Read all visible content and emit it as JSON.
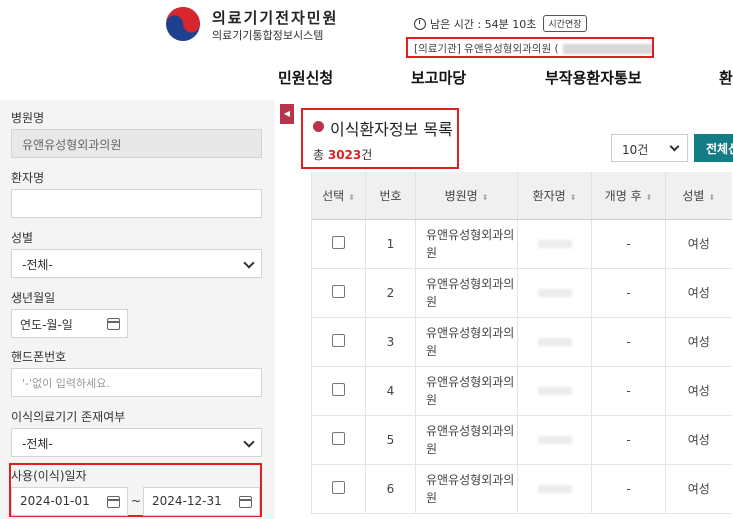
{
  "brand": {
    "title": "의료기기전자민원",
    "subtitle": "의료기기통합정보시스템"
  },
  "session": {
    "remaining_label": "남은 시간 : 54분 10초",
    "extend_label": "시간연장"
  },
  "institution_label": "[의료기관] 유앤유성형외과의원 (",
  "nav": [
    "민원신청",
    "보고마당",
    "부작용환자통보",
    "환"
  ],
  "sidebar": {
    "hospital_label": "병원명",
    "hospital_value": "유앤유성형외과의원",
    "patient_label": "환자명",
    "patient_value": "",
    "gender_label": "성별",
    "gender_value": "-전체-",
    "birth_label": "생년월일",
    "birth_value": "연도-월-일",
    "phone_label": "핸드폰번호",
    "phone_placeholder": "'-'없이 입력하세요.",
    "device_label": "이식의료기기 존재여부",
    "device_value": "-전체-",
    "usage_label": "사용(이식)일자",
    "date_from": "2024-01-01",
    "date_sep": "~",
    "date_to": "2024-12-31"
  },
  "collapse_symbol": "◀",
  "main": {
    "list_title": "이식환자정보 목록",
    "total_prefix": "총 ",
    "total_count": "3023",
    "total_suffix": "건",
    "page_size": "10건",
    "action_button": "전체선"
  },
  "table": {
    "headers": [
      "선택",
      "번호",
      "병원명",
      "환자명",
      "개명 후",
      "성별"
    ],
    "rows": [
      {
        "no": "1",
        "hospital": "유앤유성형외과의원",
        "rename": "-",
        "gender": "여성"
      },
      {
        "no": "2",
        "hospital": "유앤유성형외과의원",
        "rename": "-",
        "gender": "여성"
      },
      {
        "no": "3",
        "hospital": "유앤유성형외과의원",
        "rename": "-",
        "gender": "여성"
      },
      {
        "no": "4",
        "hospital": "유앤유성형외과의원",
        "rename": "-",
        "gender": "여성"
      },
      {
        "no": "5",
        "hospital": "유앤유성형외과의원",
        "rename": "-",
        "gender": "여성"
      },
      {
        "no": "6",
        "hospital": "유앤유성형외과의원",
        "rename": "-",
        "gender": "여성"
      }
    ]
  },
  "colors": {
    "highlight": "#e02020",
    "accent": "#b8344a",
    "teal": "#147c84"
  }
}
